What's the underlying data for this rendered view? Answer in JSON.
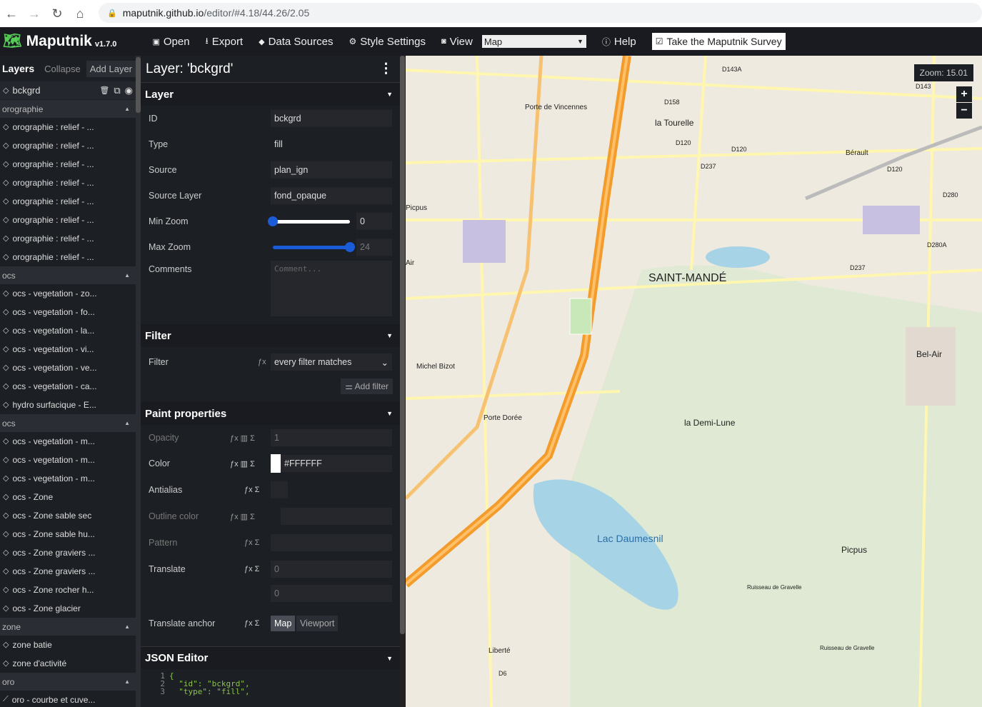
{
  "browser": {
    "url_host": "maputnik.github.io",
    "url_path": "/editor/#4.18/44.26/2.05"
  },
  "nav": {
    "app": "Maputnik",
    "version": "v1.7.0",
    "open": "Open",
    "export": "Export",
    "sources": "Data Sources",
    "style": "Style Settings",
    "view": "View",
    "view_value": "Map",
    "help": "Help",
    "survey": "Take the Maputnik Survey"
  },
  "layers": {
    "title": "Layers",
    "collapse": "Collapse",
    "add": "Add Layer",
    "selected": "bckgrd",
    "groups": [
      {
        "name": "orographie",
        "items": [
          "orographie : relief - ...",
          "orographie : relief - ...",
          "orographie : relief - ...",
          "orographie : relief - ...",
          "orographie : relief - ...",
          "orographie : relief - ...",
          "orographie : relief - ...",
          "orographie : relief - ..."
        ]
      },
      {
        "name": "ocs",
        "items": [
          "ocs - vegetation - zo...",
          "ocs - vegetation - fo...",
          "ocs - vegetation - la...",
          "ocs - vegetation - vi...",
          "ocs - vegetation - ve...",
          "ocs - vegetation - ca..."
        ]
      },
      {
        "name": "",
        "items": [
          "hydro surfacique - E..."
        ]
      },
      {
        "name": "ocs",
        "items": [
          "ocs - vegetation - m...",
          "ocs - vegetation - m...",
          "ocs - vegetation - m...",
          "ocs - Zone",
          "ocs - Zone sable sec",
          "ocs - Zone sable hu...",
          "ocs - Zone graviers ...",
          "ocs - Zone graviers ...",
          "ocs - Zone rocher h...",
          "ocs - Zone glacier"
        ]
      },
      {
        "name": "zone",
        "items": [
          "zone batie",
          "zone d'activité"
        ]
      },
      {
        "name": "oro",
        "items": [
          "oro - courbe et cuve..."
        ]
      }
    ]
  },
  "editor": {
    "title": "Layer: 'bckgrd'",
    "layer_section": "Layer",
    "fields": [
      {
        "label": "ID",
        "value": "bckgrd"
      },
      {
        "label": "Type",
        "value": "fill"
      },
      {
        "label": "Source",
        "value": "plan_ign"
      },
      {
        "label": "Source Layer",
        "value": "fond_opaque"
      }
    ],
    "min_zoom_label": "Min Zoom",
    "min_zoom": 0,
    "max_zoom_label": "Max Zoom",
    "max_zoom": 24,
    "comments_label": "Comments",
    "comments_placeholder": "Comment...",
    "filter_section": "Filter",
    "filter_label": "Filter",
    "filter_value": "every filter matches",
    "add_filter": "Add filter",
    "paint_section": "Paint properties",
    "opacity_label": "Opacity",
    "opacity": "1",
    "color_label": "Color",
    "color": "#FFFFFF",
    "antialias_label": "Antialias",
    "outline_label": "Outline color",
    "pattern_label": "Pattern",
    "translate_label": "Translate",
    "translate_x": "0",
    "translate_y": "0",
    "anchor_label": "Translate anchor",
    "anchor_map": "Map",
    "anchor_viewport": "Viewport",
    "json_section": "JSON Editor",
    "json_lines": [
      {
        "n": "1",
        "t": "{"
      },
      {
        "n": "2",
        "t": "  \"id\": \"bckgrd\","
      },
      {
        "n": "3",
        "t": "  \"type\": \"fill\","
      }
    ]
  },
  "map": {
    "zoom": "Zoom: 15.01",
    "zoom_in": "+",
    "zoom_out": "−",
    "labels": {
      "saint_mande": "SAINT-MANDÉ",
      "tourelle": "la Tourelle",
      "demilune": "la Demi-Lune",
      "lac": "Lac Daumesnil",
      "picpus": "Picpus",
      "picpus2": "Picpus",
      "belair": "Bel-Air",
      "berault": "Bérault",
      "bizot": "Michel Bizot",
      "doree": "Porte Dorée",
      "liberte": "Liberté",
      "porte_vin": "Porte de Vincennes",
      "d120a": "D120",
      "d120b": "D120",
      "d120c": "D120",
      "d143": "D143",
      "d143a": "D143A",
      "d237a": "D237",
      "d237b": "D237",
      "d158": "D158",
      "d280": "D280",
      "d280a": "D280A",
      "d6": "D6",
      "ruisseau1": "Ruisseau de Gravelle",
      "ruisseau2": "Ruisseau de Gravelle",
      "air": "Air"
    }
  }
}
